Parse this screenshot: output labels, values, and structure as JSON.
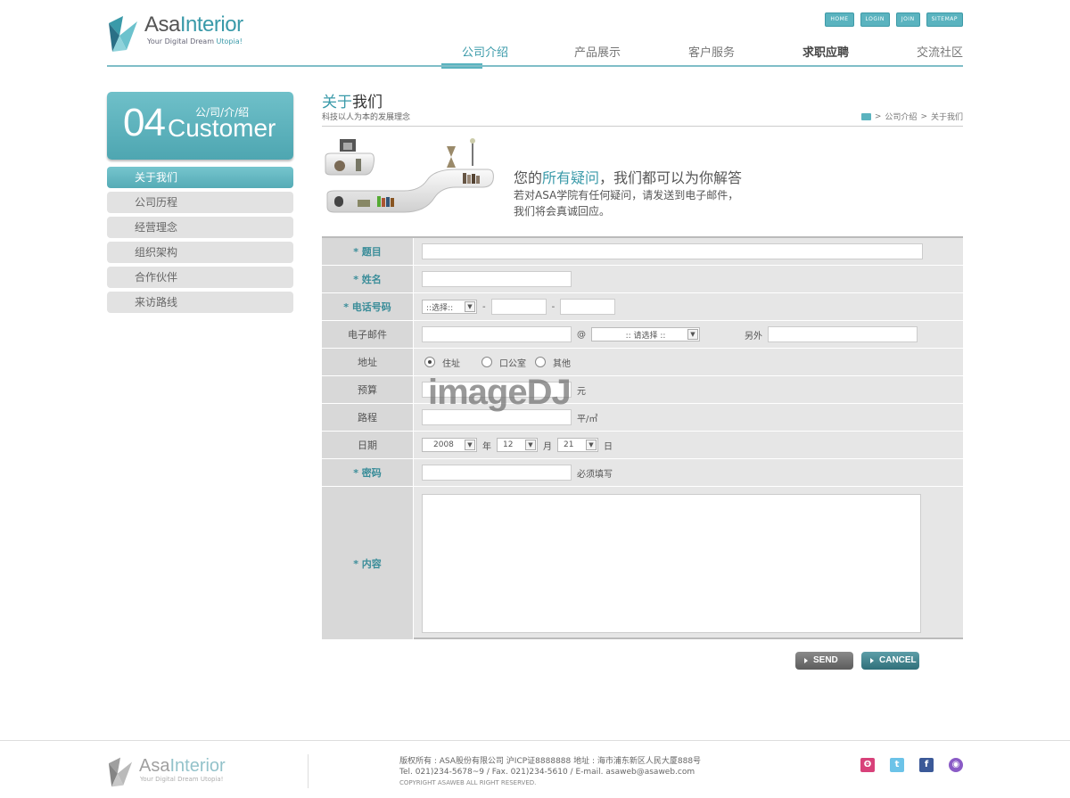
{
  "header": {
    "logo": {
      "name_a": "Asa",
      "name_b": "Interior",
      "tag_a": "Your Digital Dream ",
      "tag_b": "Utopia!"
    },
    "toplinks": [
      "HOME",
      "LOGIN",
      "JOIN",
      "SITEMAP"
    ],
    "nav": [
      {
        "label": "公司介绍",
        "active": true
      },
      {
        "label": "产品展示"
      },
      {
        "label": "客户服务"
      },
      {
        "label": "求职应聘",
        "bold": true
      },
      {
        "label": "交流社区"
      }
    ]
  },
  "left": {
    "badge": {
      "num": "04",
      "word": "Customer",
      "cn": "公/司/介/绍"
    },
    "menu": [
      "关于我们",
      "公司历程",
      "经营理念",
      "组织架构",
      "合作伙伴",
      "来访路线"
    ]
  },
  "content": {
    "title_a": "关于",
    "title_b": "我们",
    "subtitle": "科技以人为本的发展理念",
    "breadcrumb": [
      ">",
      "公司介绍",
      ">",
      "关于我们"
    ],
    "message": {
      "a": "您的",
      "b": "所有疑问",
      "c": "，我们都可以为你解答",
      "line2": "若对ASA学院有任何疑问，请发送到电子邮件，",
      "line3": "我们将会真诚回应。"
    }
  },
  "form": {
    "labels": {
      "subject": "* 题目",
      "name": "* 姓名",
      "phone": "* 电话号码",
      "email": "电子邮件",
      "address": "地址",
      "budget": "预算",
      "route": "路程",
      "date": "日期",
      "password": "* 密码",
      "content": "* 内容"
    },
    "phone_select": "::选择::",
    "dash": "-",
    "at": "@",
    "email_select": ":: 请选择 ::",
    "other": "另外",
    "address_options": [
      "住址",
      "口公室",
      "其他"
    ],
    "budget_unit": "元",
    "route_unit": "平/㎡",
    "date": {
      "year": "2008",
      "year_unit": "年",
      "month": "12",
      "month_unit": "月",
      "day": "21",
      "day_unit": "日"
    },
    "password_hint": "必须填写",
    "send": "SEND",
    "cancel": "CANCEL"
  },
  "watermark": "imageDJ",
  "footer": {
    "logo": {
      "name_a": "Asa",
      "name_b": "Interior",
      "tag": "Your Digital Dream Utopia!"
    },
    "line1": "版权所有 : ASA股份有限公司 沪ICP证8888888   地址 : 海市浦东新区人民大厦888号",
    "line2": "Tel. 021)234-5678~9  / Fax. 021)234-5610  / E-mail. asaweb@asaweb.com",
    "line3": "COPYRIGHT ASAWEB ALL RIGHT RESERVED."
  },
  "colors": {
    "accent": "#3a9aa9",
    "nav_bar": "#5ab3bf"
  }
}
